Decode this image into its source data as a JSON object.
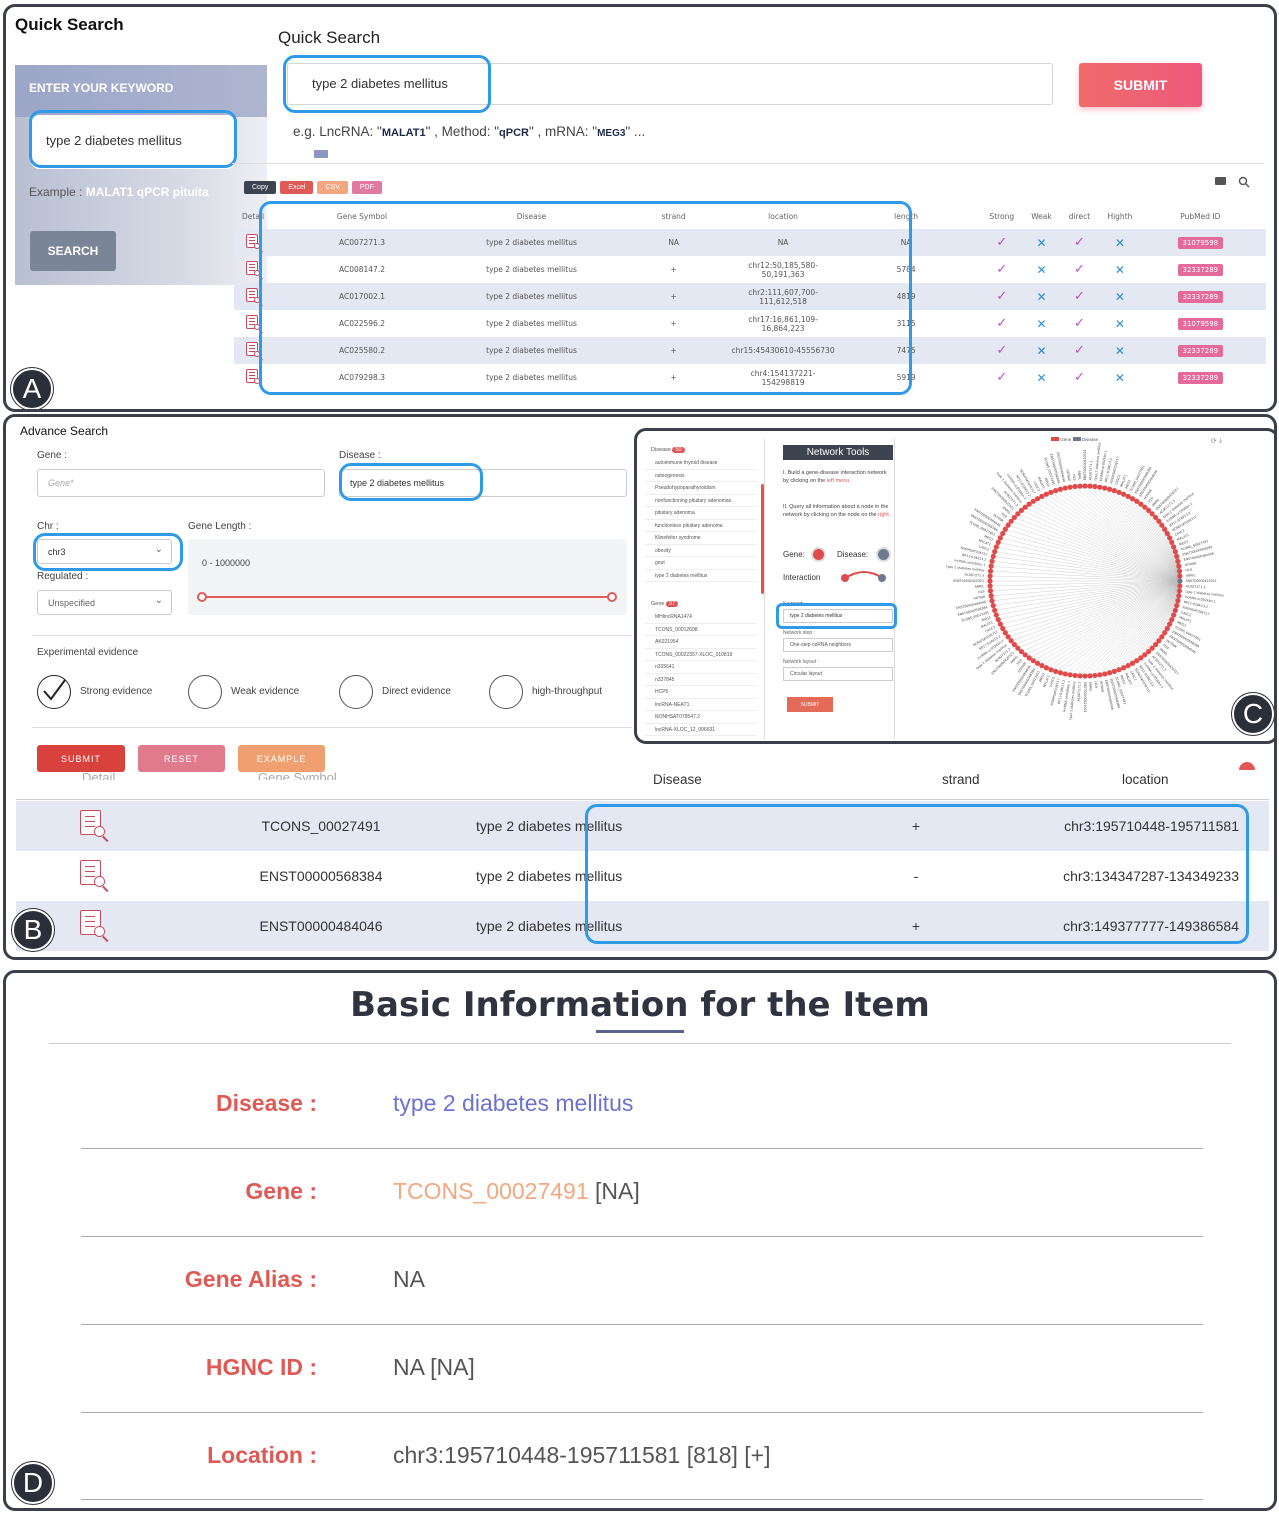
{
  "panels": {
    "a": "A",
    "b": "B",
    "c": "C",
    "d": "D"
  },
  "quick_search": {
    "sidebar_title": "Quick Search",
    "sidebar_header": "ENTER YOUR KEYWORD",
    "sidebar_input_value": "type 2 diabetes mellitus",
    "example_prefix": "Example :",
    "example_value": "MALAT1  qPCR  pituita",
    "search_button": "SEARCH",
    "main_title": "Quick Search",
    "main_input_value": "type 2 diabetes mellitus",
    "submit_button": "SUBMIT",
    "hint": {
      "p1": "e.g. LncRNA: \"",
      "b1": "MALAT1",
      "p2": "\" , Method: \"",
      "b2": "qPCR",
      "p3": "\" , mRNA: \"",
      "b3": "MEG3",
      "p4": "\" ..."
    },
    "export_buttons": [
      "Copy",
      "Excel",
      "CSV",
      "PDF"
    ],
    "export_colors": [
      "#3d4450",
      "#e05a55",
      "#f2a77e",
      "#e07aa0"
    ],
    "columns": [
      "Detail",
      "Gene Symbol",
      "Disease",
      "strand",
      "location",
      "length",
      "Strong",
      "Weak",
      "direct",
      "Highth",
      "PubMed ID"
    ],
    "rows": [
      {
        "gene": "AC007271.3",
        "disease": "type 2 diabetes mellitus",
        "strand": "NA",
        "location": "NA",
        "length": "NA",
        "pubmed": "31079598"
      },
      {
        "gene": "AC008147.2",
        "disease": "type 2 diabetes mellitus",
        "strand": "+",
        "location": "chr12:50,185,580-50,191,363",
        "length": "5784",
        "pubmed": "32337289"
      },
      {
        "gene": "AC017002.1",
        "disease": "type 2 diabetes mellitus",
        "strand": "+",
        "location": "chr2:111,607,700-111,612,518",
        "length": "4819",
        "pubmed": "32337289"
      },
      {
        "gene": "AC022596.2",
        "disease": "type 2 diabetes mellitus",
        "strand": "+",
        "location": "chr17:16,861,109-16,864,223",
        "length": "3115",
        "pubmed": "31079598"
      },
      {
        "gene": "AC025580.2",
        "disease": "type 2 diabetes mellitus",
        "strand": "+",
        "location": "chr15:45430610-45556730",
        "length": "7475",
        "pubmed": "32337289"
      },
      {
        "gene": "AC079298.3",
        "disease": "type 2 diabetes mellitus",
        "strand": "+",
        "location": "chr4:154137221-154298819",
        "length": "5919",
        "pubmed": "32337289"
      }
    ],
    "check_symbol": "✓",
    "cross_symbol": "✕"
  },
  "advance_search": {
    "title": "Advance Search",
    "gene_label": "Gene :",
    "gene_placeholder": "Gene*",
    "disease_label": "Disease :",
    "disease_value": "type 2 diabetes mellitus",
    "chr_label": "Chr :",
    "chr_value": "chr3",
    "gene_length_label": "Gene Length :",
    "gene_length_range": "0 - 1000000",
    "regulated_label": "Regulated :",
    "regulated_value": "Unspecified",
    "evidence_title": "Experimental evidence",
    "evidence": [
      {
        "label": "Strong evidence",
        "checked": true
      },
      {
        "label": "Weak evidence",
        "checked": false
      },
      {
        "label": "Direct evidence",
        "checked": false
      },
      {
        "label": "high-throughput",
        "checked": false
      }
    ],
    "buttons": {
      "submit": "SUBMIT",
      "reset": "RESET",
      "example": "EXAMPLE"
    },
    "columns": {
      "detail": "Detail",
      "gene_symbol": "Gene Symbol",
      "disease": "Disease",
      "strand": "strand",
      "location": "location"
    },
    "rows": [
      {
        "gene": "TCONS_00027491",
        "disease": "type 2 diabetes mellitus",
        "strand": "+",
        "location": "chr3:195710448-195711581"
      },
      {
        "gene": "ENST00000568384",
        "disease": "type 2 diabetes mellitus",
        "strand": "-",
        "location": "chr3:134347287-134349233"
      },
      {
        "gene": "ENST00000484046",
        "disease": "type 2 diabetes mellitus",
        "strand": "+",
        "location": "chr3:149377777-149386584"
      }
    ]
  },
  "network_tools": {
    "side_disease_header": "Disease",
    "side_disease_count": "50",
    "disease_list": [
      "autoimmune thyroid disease",
      "osteogenesis",
      "Pseudohypoparathyroidism",
      "nonfunctioning pituitary adenomas",
      "pituitary adenoma",
      "functionless pituitary adenoma",
      "Klinefelter syndrome",
      "obesity",
      "gout",
      "type 2 diabetes mellitus"
    ],
    "side_gene_header": "Gene",
    "side_gene_count": "97",
    "gene_list": [
      "MHlincRNA1474",
      "TCONS_00012608",
      "AK021954",
      "TCONS_00022357-XLOC_010819",
      "n335641",
      "n337845",
      "HCP5",
      "lncRNA-NEAT1",
      "NONHSAT079547.2",
      "lncRNA-XLOC_12_006631"
    ],
    "title": "Network Tools",
    "instruction1": "I. Build a gene-disease interaction network by clicking on the ",
    "instruction1_hl": "left menu.",
    "instruction2": "II. Query all information about a node in the network by clicking on the node on the ",
    "instruction2_hl": "right.",
    "gene_toggle": "Gene:",
    "disease_toggle": "Disease:",
    "interaction_toggle": "Interaction",
    "keyword_label": "Keyword:",
    "keyword_value": "type 2 diabetes mellitus",
    "step_label": "Network step :",
    "step_value": "One-step ceRNA neighbors",
    "layout_label": "Network layout :",
    "layout_value": "Circular layout",
    "submit": "SUBMIT",
    "legend_gene": "Gene",
    "legend_disease": "Disease",
    "gene_color": "#e04a4a",
    "disease_color": "#6e7a90",
    "node_label_sample": [
      "ENST00000420321",
      "AC007271.3",
      "type 2 diabetes mellitus",
      "lncRNA-uc002kbn.1",
      "RP11-618K13.2",
      "NONHSAT036717",
      "CASC2",
      "MALAT1",
      "MEG3",
      "TCONS_00027491",
      "ENST00000568384",
      "ENST00000484046",
      "HOTAIR",
      "H19",
      "ANRIL"
    ]
  },
  "basic_info": {
    "title": "Basic Information for the Item",
    "disease_label": "Disease :",
    "disease_value": "type 2 diabetes mellitus",
    "gene_label": "Gene :",
    "gene_value": "TCONS_00027491",
    "gene_suffix": "[NA]",
    "alias_label": "Gene Alias :",
    "alias_value": "NA",
    "hgnc_label": "HGNC ID :",
    "hgnc_value": "NA [NA]",
    "location_label": "Location :",
    "location_value": "chr3:195710448-195711581 [818] [+]"
  }
}
